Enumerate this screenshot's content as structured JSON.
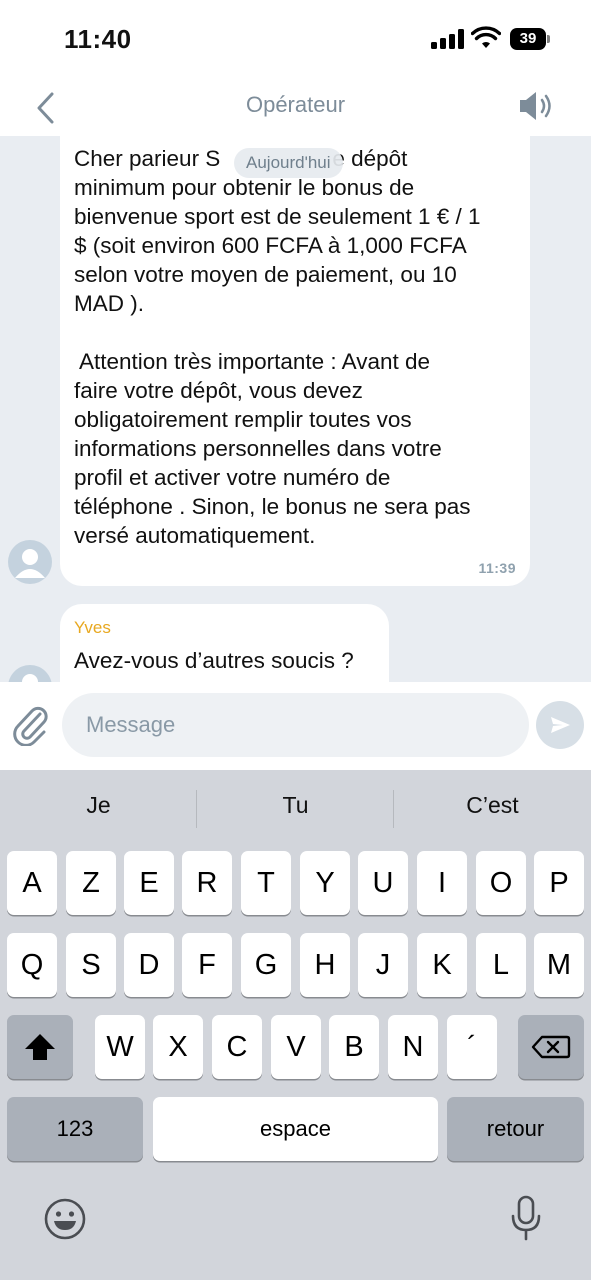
{
  "status_bar": {
    "time": "11:40",
    "battery": "39"
  },
  "header": {
    "title": "Opérateur",
    "back_icon": "chevron-left-icon",
    "speaker_icon": "speaker-icon"
  },
  "chat": {
    "date_pill": "Aujourd'hui",
    "messages": [
      {
        "paragraph1_lines": [
          "Cher parieur S",
          "minimum pour obtenir le bonus de",
          "bienvenue sport est de seulement 1 € / 1",
          "$ (soit environ 600 FCFA à 1,000 FCFA",
          "selon votre moyen de paiement, ou 10",
          "MAD )."
        ],
        "line1_tail": "e dépôt",
        "paragraph2_lines": [
          " Attention très importante : Avant de",
          "faire votre dépôt, vous devez",
          "obligatoirement remplir toutes vos",
          "informations personnelles dans votre",
          "profil et activer votre numéro de",
          "téléphone . Sinon, le bonus ne sera pas",
          "versé automatiquement."
        ],
        "time": "11:39"
      },
      {
        "sender": "Yves",
        "text": "Avez-vous d’autres soucis ?"
      }
    ]
  },
  "input": {
    "placeholder": "Message"
  },
  "keyboard": {
    "suggestions": [
      "Je",
      "Tu",
      "C’est"
    ],
    "row1": [
      "A",
      "Z",
      "E",
      "R",
      "T",
      "Y",
      "U",
      "I",
      "O",
      "P"
    ],
    "row2": [
      "Q",
      "S",
      "D",
      "F",
      "G",
      "H",
      "J",
      "K",
      "L",
      "M"
    ],
    "row3": [
      "W",
      "X",
      "C",
      "V",
      "B",
      "N",
      "´"
    ],
    "numbers_label": "123",
    "space_label": "espace",
    "return_label": "retour"
  },
  "colors": {
    "sender": "#e8a820",
    "header_title": "#7d8c99",
    "chat_bg": "#e9edf2",
    "keyboard_bg": "#d2d5db"
  }
}
